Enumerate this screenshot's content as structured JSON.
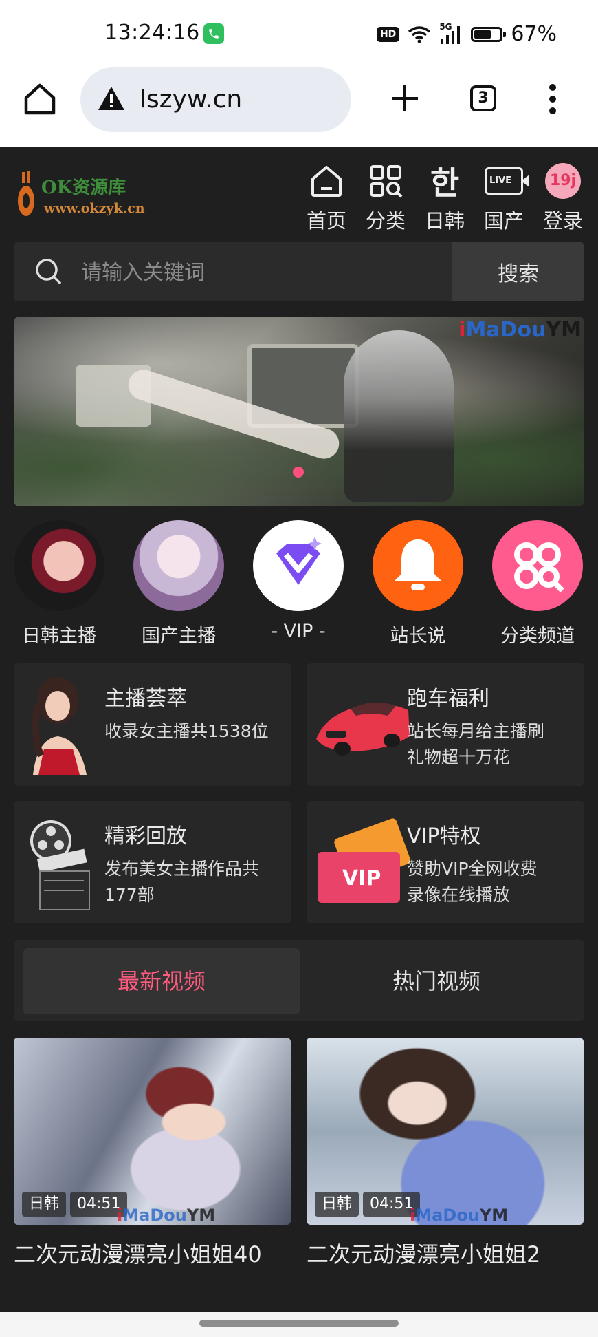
{
  "status_bar": {
    "time": "13:24:16",
    "hd": "HD",
    "network": "5G",
    "battery": "67%",
    "battery_level": 0.67
  },
  "browser": {
    "url": "lszyw.cn",
    "tab_count": "3"
  },
  "site": {
    "logo_text": "OK资源库",
    "logo_url": "www.okzyk.cn",
    "nav": [
      {
        "label": "首页",
        "icon": "home-icon"
      },
      {
        "label": "分类",
        "icon": "grid-search-icon"
      },
      {
        "label": "日韩",
        "icon": "hangul-icon",
        "glyph": "한"
      },
      {
        "label": "国产",
        "icon": "live-tv-icon",
        "glyph": "LIVE"
      },
      {
        "label": "登录",
        "icon": "19j-badge-icon",
        "glyph": "19j"
      }
    ]
  },
  "search": {
    "placeholder": "请输入关键词",
    "button": "搜索"
  },
  "banner": {
    "watermark_a": "i",
    "watermark_b": "MaDou",
    "watermark_c": "YM"
  },
  "shortcuts": [
    {
      "label": "日韩主播",
      "icon": "avatar-image"
    },
    {
      "label": "国产主播",
      "icon": "avatar-image"
    },
    {
      "label": "- VIP -",
      "icon": "diamond-icon"
    },
    {
      "label": "站长说",
      "icon": "bell-icon"
    },
    {
      "label": "分类频道",
      "icon": "grid-search-icon"
    }
  ],
  "features": [
    {
      "title": "主播荟萃",
      "desc": "收录女主播共1538位",
      "icon": "woman-portrait-image"
    },
    {
      "title": "跑车福利",
      "desc": "站长每月给主播刷礼物超十万花",
      "icon": "sports-car-image"
    },
    {
      "title": "精彩回放",
      "desc": "发布美女主播作品共177部",
      "icon": "film-reel-icon"
    },
    {
      "title": "VIP特权",
      "desc": "赞助VIP全网收费录像在线播放",
      "icon": "vip-ticket-icon"
    }
  ],
  "tabs": {
    "latest": "最新视频",
    "hot": "热门视频"
  },
  "videos": [
    {
      "category": "日韩",
      "duration": "04:51",
      "title": "二次元动漫漂亮小姐姐40"
    },
    {
      "category": "日韩",
      "duration": "04:51",
      "title": "二次元动漫漂亮小姐姐2"
    }
  ],
  "colors": {
    "accent": "#ff5b7f",
    "bg": "#1f1f1f",
    "card": "#272727",
    "bell": "#ff6211",
    "category": "#ff5b8f",
    "vip": "#7b4cf2"
  }
}
